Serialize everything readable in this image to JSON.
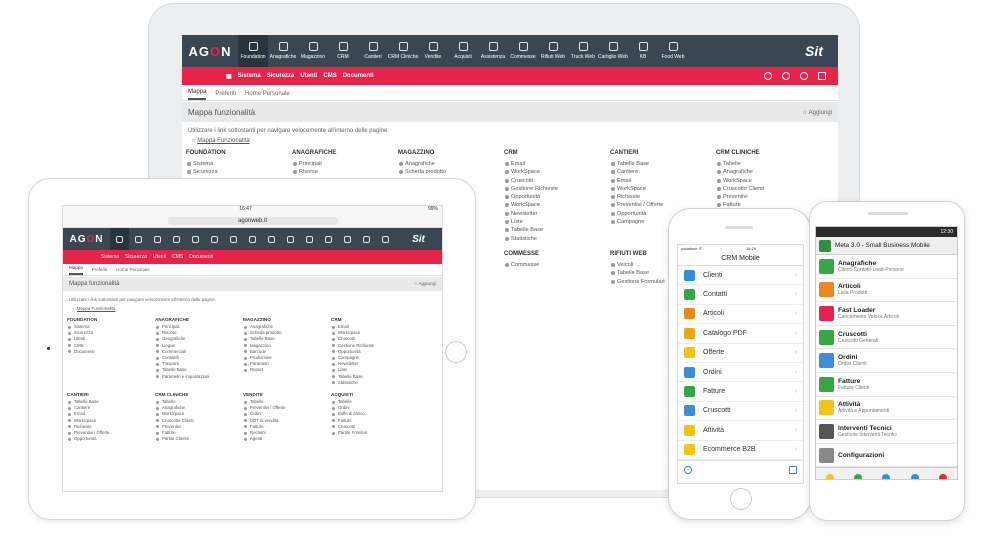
{
  "desktop": {
    "logo": {
      "pre": "AG",
      "mid": "O",
      "post": "N"
    },
    "sit_logo": "Sit",
    "modules": [
      "Foundation",
      "Anagrafiche",
      "Magazzino",
      "CRM",
      "Cantieri",
      "CRM Cliniche",
      "Vendite",
      "Acquisti",
      "Assistenza",
      "Commesse",
      "Rifiuti Web",
      "Truck Web",
      "Cartiglio Web",
      "KB",
      "Food Web"
    ],
    "redbar_items": [
      "Sistema",
      "Sicurezza",
      "Utenti",
      "CMS",
      "Documenti"
    ],
    "tabs": [
      "Mappa",
      "Preferiti",
      "Home Personale"
    ],
    "page_title": "Mappa funzionalità",
    "add_label": "Aggiungi",
    "hint": "Utilizzare i link sottostanti per navigare velocemente all'interno delle pagine.",
    "map_link": "Mappa Funzionalità",
    "columns": [
      {
        "title": "FOUNDATION",
        "items": [
          "Sistema",
          "Sicurezza"
        ]
      },
      {
        "title": "ANAGRAFICHE",
        "items": [
          "Principali",
          "Risorse"
        ]
      },
      {
        "title": "MAGAZZINO",
        "items": [
          "Anagrafiche",
          "Scheda prodotto"
        ]
      },
      {
        "title": "CRM",
        "items": [
          "Email",
          "WorkSpace",
          "Cruscotti",
          "Gestione Richieste",
          "Opportunità",
          "WorkSpace",
          "Newsletter",
          "Liste",
          "Tabelle Base",
          "Statistiche"
        ]
      },
      {
        "title": "CANTIERI",
        "items": [
          "Tabelle Base",
          "Cantiere",
          "Email",
          "WorkSpace",
          "Richieste",
          "Preventivi / Offerte",
          "Opportunità",
          "Campagne"
        ]
      },
      {
        "title": "CRM CLINICHE",
        "items": [
          "Tabelle",
          "Anagrafiche",
          "WorkSpace",
          "Cruscotto Clienti",
          "Preventivi",
          "Fatture"
        ]
      },
      {
        "title": "",
        "items": []
      },
      {
        "title": "",
        "items": []
      },
      {
        "title": "",
        "items": []
      },
      {
        "title": "COMMESSE",
        "items": [
          "Commesse"
        ]
      },
      {
        "title": "RIFIUTI WEB",
        "items": [
          "Veicoli",
          "Tabelle Base",
          "Gestione Formulari"
        ]
      }
    ]
  },
  "tablet": {
    "time": "16:47",
    "battery": "99%",
    "url": "agonweb.it",
    "logo": {
      "pre": "AG",
      "mid": "O",
      "post": "N"
    },
    "sit_logo": "Sit",
    "redbar_items": [
      "Sistema",
      "Sicurezza",
      "Utenti",
      "CMS",
      "Documenti"
    ],
    "tabs": [
      "Mappa",
      "Preferiti",
      "Home Personale"
    ],
    "page_title": "Mappa funzionalità",
    "add_label": "Aggiungi",
    "hint": "Utilizzare i link sottostanti per navigare velocemente all'interno delle pagine.",
    "map_link": "Mappa Funzionalità",
    "columns": [
      {
        "title": "FOUNDATION",
        "items": [
          "Sistema",
          "Sicurezza",
          "Utenti",
          "CMS",
          "Documenti"
        ]
      },
      {
        "title": "ANAGRAFICHE",
        "items": [
          "Principali",
          "Risorse",
          "Geografiche",
          "Lingue",
          "Commerciali",
          "Contabili",
          "Trasporti",
          "Tabelle Base",
          "Parametri e impostazioni"
        ]
      },
      {
        "title": "MAGAZZINO",
        "items": [
          "Anagrafiche",
          "Scheda prodotto",
          "Tabelle Base",
          "Magazzino",
          "Barcode",
          "Produzione",
          "Parametri",
          "Report"
        ]
      },
      {
        "title": "CRM",
        "items": [
          "Email",
          "WorkSpace",
          "Cruscotti",
          "Gestione Richieste",
          "Opportunità",
          "Campagne",
          "Newsletter",
          "Liste",
          "Tabelle Base",
          "Statistiche"
        ]
      },
      {
        "title": "CANTIERI",
        "items": [
          "Tabelle Base",
          "Cantiere",
          "Email",
          "WorkSpace",
          "Richieste",
          "Preventivi / Offerte",
          "Opportunità"
        ]
      },
      {
        "title": "CRM CLINICHE",
        "items": [
          "Tabelle",
          "Anagrafiche",
          "WorkSpace",
          "Cruscotto Clienti",
          "Preventivi",
          "Fatture",
          "Partite Cliente"
        ]
      },
      {
        "title": "VENDITE",
        "items": [
          "Tabelle",
          "Preventivi / Offerte",
          "Ordini",
          "DDT di vendita",
          "Fatture",
          "Reclami",
          "Agenti"
        ]
      },
      {
        "title": "ACQUISTI",
        "items": [
          "Tabelle",
          "Ordini",
          "Bolle di carico",
          "Fatture",
          "Cruscotti",
          "Partite Fornitori"
        ]
      }
    ]
  },
  "iphone": {
    "carrier": "vodafone IT",
    "time": "16:26",
    "title": "CRM Mobile",
    "items": [
      {
        "label": "Clienti",
        "color": "#2f8fd9"
      },
      {
        "label": "Contatti",
        "color": "#35a845"
      },
      {
        "label": "Articoli",
        "color": "#e9881c"
      },
      {
        "label": "Catalogo PDF",
        "color": "#e9a81c"
      },
      {
        "label": "Offerte",
        "color": "#f0c419"
      },
      {
        "label": "Ordini",
        "color": "#3a8fd6"
      },
      {
        "label": "Fatture",
        "color": "#35a845"
      },
      {
        "label": "Cruscotti",
        "color": "#3a8fd6"
      },
      {
        "label": "Attività",
        "color": "#f0c419"
      },
      {
        "label": "Ecommerce B2B",
        "color": "#f0c419"
      }
    ]
  },
  "android": {
    "time": "12:30",
    "title": "Meta 3.0 - Small Business Mobile",
    "items": [
      {
        "title": "Anagrafiche",
        "sub": "Clienti-Contatti-Lead-Persone",
        "color": "#35a845"
      },
      {
        "title": "Articoli",
        "sub": "Lista Prodotti",
        "color": "#e9881c"
      },
      {
        "title": "Fast Loader",
        "sub": "Caricamento Veloce Articoli",
        "color": "#e8234a"
      },
      {
        "title": "Cruscotti",
        "sub": "Cruscotti Generali",
        "color": "#35a845"
      },
      {
        "title": "Ordini",
        "sub": "Ordini Clienti",
        "color": "#3a8fd6"
      },
      {
        "title": "Fatture",
        "sub": "Fatture Clienti",
        "color": "#35a845"
      },
      {
        "title": "Attività",
        "sub": "Attività e Appuntamenti",
        "color": "#f0c419"
      },
      {
        "title": "Interventi Tecnici",
        "sub": "Gestione Interventi Tecnici",
        "color": "#555555"
      },
      {
        "title": "Configurazioni",
        "sub": "",
        "color": "#888888"
      }
    ]
  }
}
